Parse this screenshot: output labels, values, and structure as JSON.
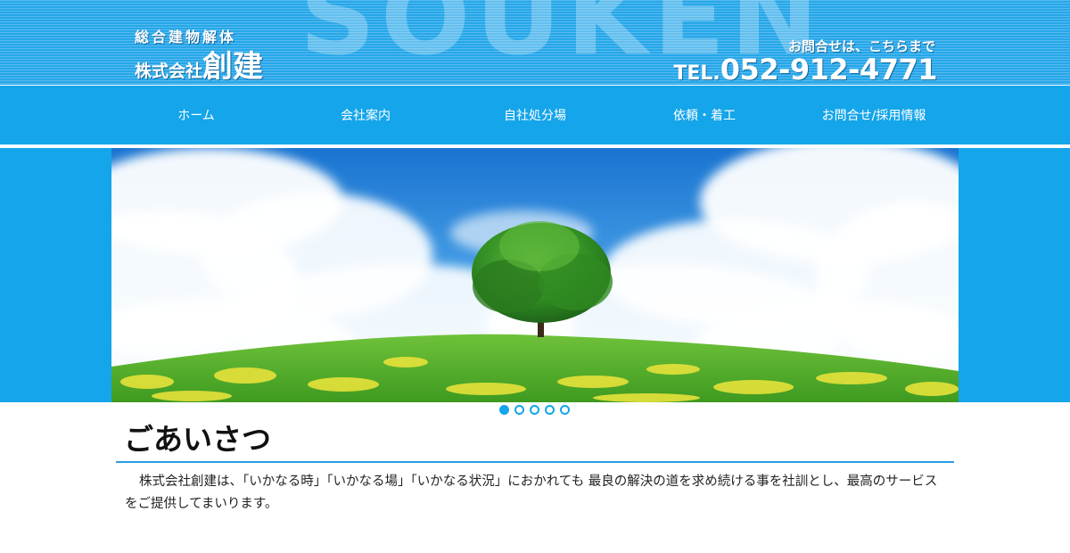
{
  "header": {
    "watermark": "SOUKEN",
    "logo_sub": "総合建物解体",
    "logo_company": "株式会社",
    "logo_brand": "創建",
    "contact_label": "お問合せは、こちらまで",
    "phone_prefix": "TEL.",
    "phone_number": "052-912-4771",
    "accent_color": "#14a5ea"
  },
  "nav": {
    "items": [
      {
        "label": "ホーム"
      },
      {
        "label": "会社案内"
      },
      {
        "label": "自社処分場"
      },
      {
        "label": "依頼・着工"
      },
      {
        "label": "お問合せ/採用情報"
      }
    ]
  },
  "slider": {
    "slide_count": 5,
    "active_index": 0
  },
  "content": {
    "title": "ごあいさつ",
    "intro": "株式会社創建は、「いかなる時」「いかなる場」「いかなる状況」におかれても 最良の解決の道を求め続ける事を社訓とし、最高のサービスをご提供してまいります。"
  }
}
